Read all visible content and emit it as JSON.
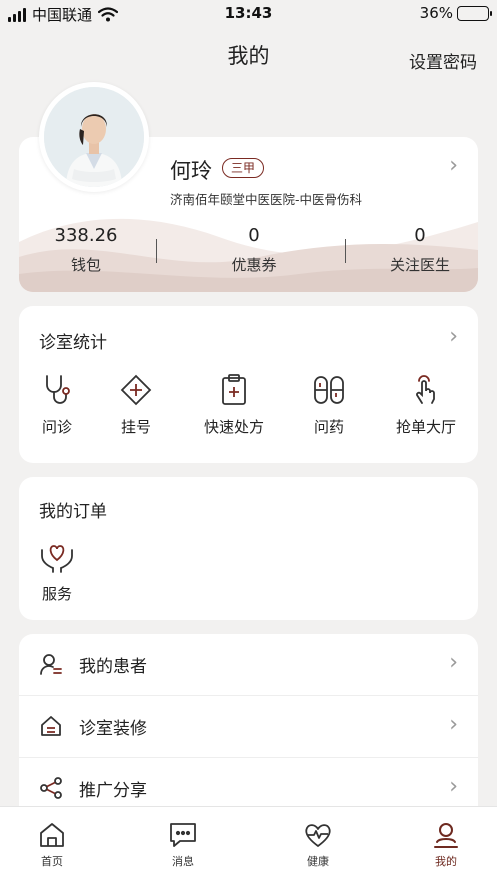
{
  "status_bar": {
    "carrier": "中国联通",
    "time": "13:43",
    "battery": "36%",
    "battery_level": 0.36
  },
  "header": {
    "title": "我的",
    "action": "设置密码"
  },
  "profile": {
    "name": "何玲",
    "badge": "三甲",
    "hospital": "济南佰年颐堂中医医院-中医骨伤科",
    "stats": [
      {
        "value": "338.26",
        "label": "钱包"
      },
      {
        "value": "0",
        "label": "优惠券"
      },
      {
        "value": "0",
        "label": "关注医生"
      }
    ]
  },
  "clinic_stats": {
    "title": "诊室统计",
    "items": [
      {
        "label": "问诊",
        "icon": "stethoscope-icon"
      },
      {
        "label": "挂号",
        "icon": "register-icon"
      },
      {
        "label": "快速处方",
        "icon": "prescription-icon"
      },
      {
        "label": "问药",
        "icon": "pill-icon"
      },
      {
        "label": "抢单大厅",
        "icon": "tap-hand-icon"
      }
    ]
  },
  "orders": {
    "title": "我的订单",
    "items": [
      {
        "label": "服务",
        "icon": "heart-hand-icon"
      }
    ]
  },
  "menu": [
    {
      "label": "我的患者",
      "icon": "patient-icon"
    },
    {
      "label": "诊室装修",
      "icon": "home-decor-icon"
    },
    {
      "label": "推广分享",
      "icon": "share-icon"
    }
  ],
  "tabbar": [
    {
      "label": "首页",
      "icon": "home-icon"
    },
    {
      "label": "消息",
      "icon": "message-icon"
    },
    {
      "label": "健康",
      "icon": "health-icon"
    },
    {
      "label": "我的",
      "icon": "user-icon",
      "active": true
    }
  ],
  "colors": {
    "accent": "#6e2a20",
    "background": "#f2f1f0",
    "wave": "#e9ddd8"
  }
}
